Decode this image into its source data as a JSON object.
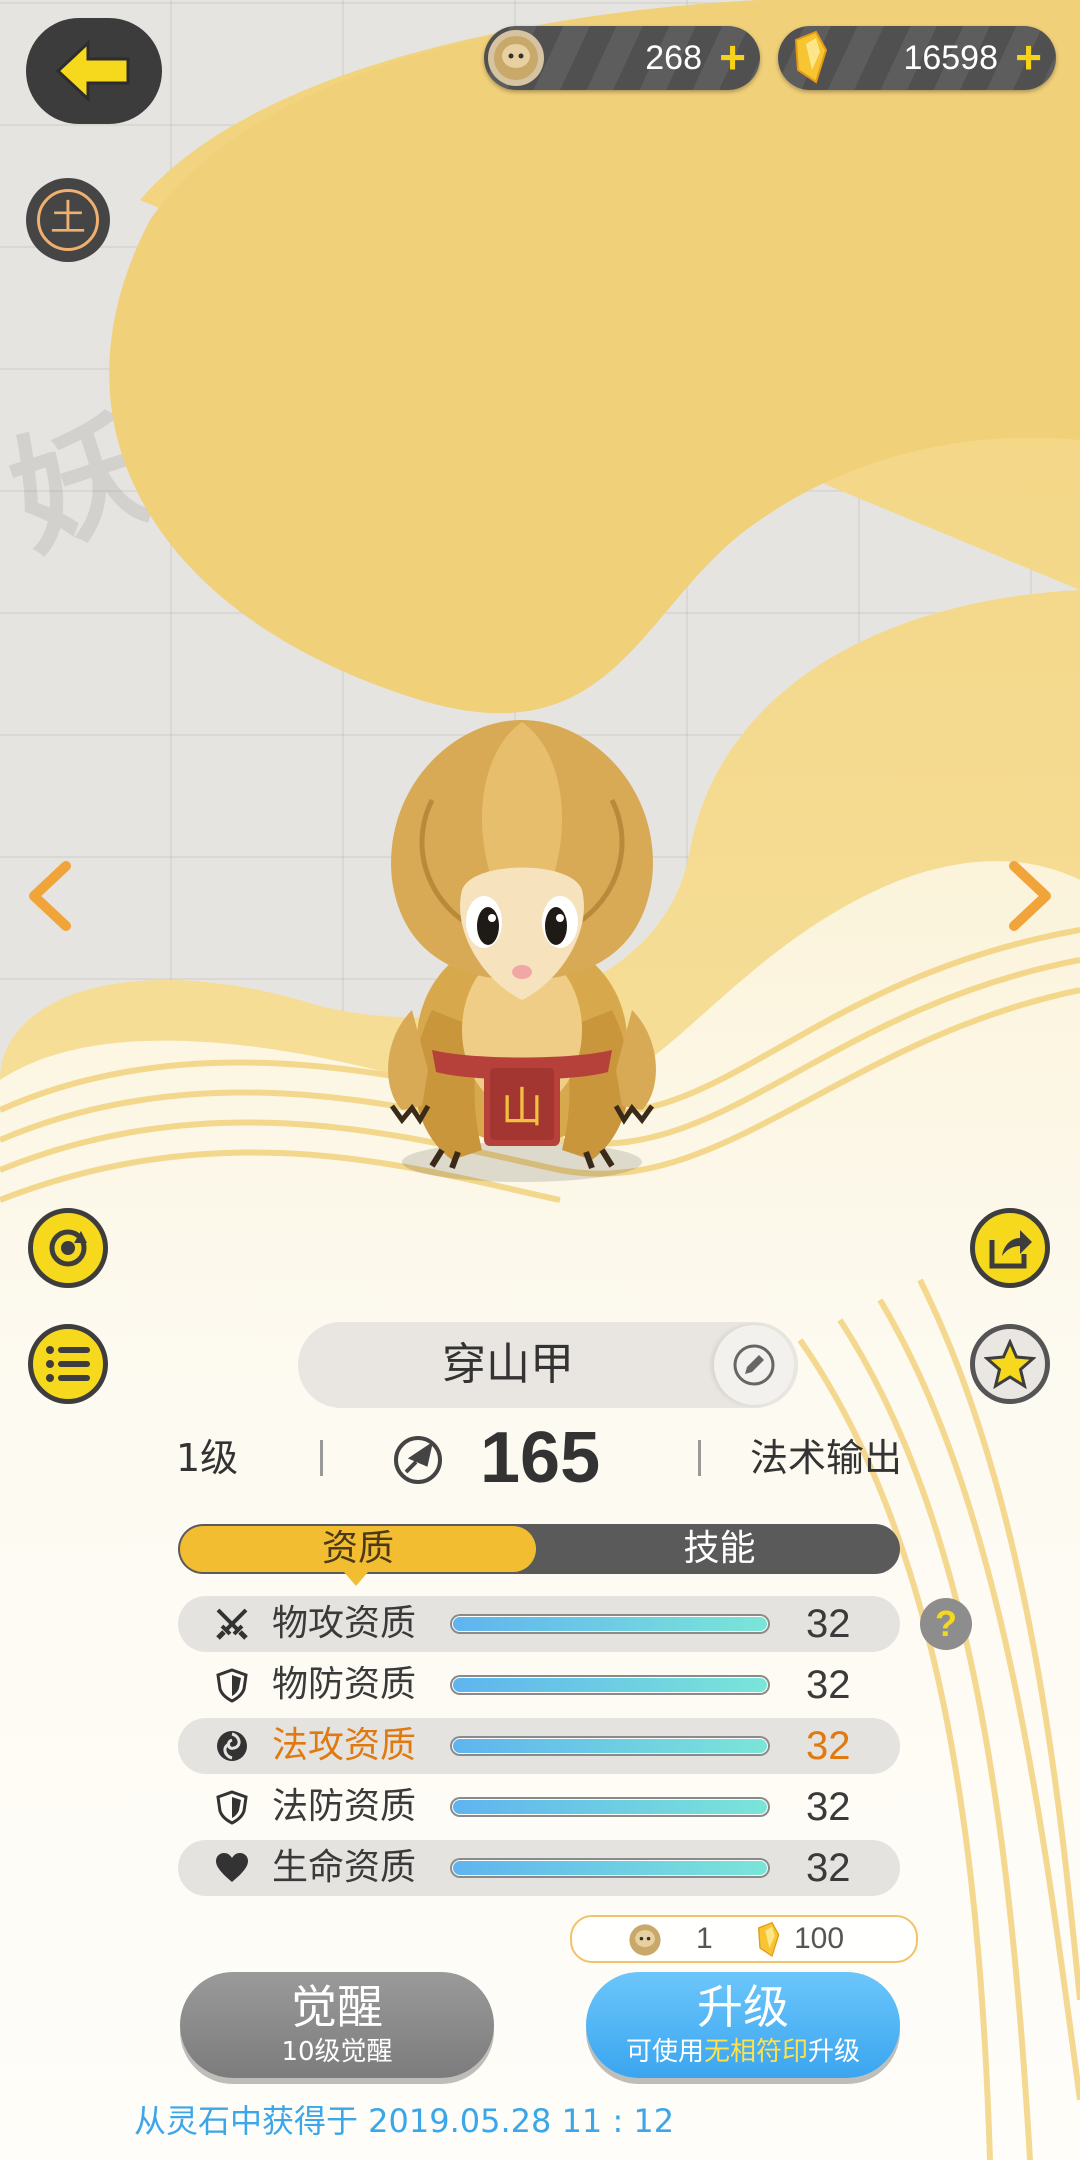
{
  "currency": {
    "creature_count": "268",
    "crystal_count": "16598",
    "plus": "+"
  },
  "element_badge": "土",
  "pet": {
    "name": "穿山甲",
    "level": "1级",
    "power": "165",
    "role": "法术输出",
    "belly_glyph": "山"
  },
  "tabs": [
    {
      "label": "资质",
      "active": true
    },
    {
      "label": "技能",
      "active": false
    }
  ],
  "attributes": [
    {
      "icon": "crossed-swords-icon",
      "label": "物攻资质",
      "value": "32",
      "fill": 1.0,
      "highlight": false
    },
    {
      "icon": "shield-icon",
      "label": "物防资质",
      "value": "32",
      "fill": 1.0,
      "highlight": false
    },
    {
      "icon": "magic-swirl-icon",
      "label": "法攻资质",
      "value": "32",
      "fill": 1.0,
      "highlight": true
    },
    {
      "icon": "shield-icon",
      "label": "法防资质",
      "value": "32",
      "fill": 1.0,
      "highlight": false
    },
    {
      "icon": "heart-icon",
      "label": "生命资质",
      "value": "32",
      "fill": 1.0,
      "highlight": false
    }
  ],
  "help": "?",
  "cost": {
    "creature_amount": "1",
    "crystal_amount": "100"
  },
  "awaken_button": {
    "label": "觉醒",
    "sub": "10级觉醒"
  },
  "upgrade_button": {
    "label": "升级",
    "sub_prefix": "可使用",
    "sub_highlight": "无相符印",
    "sub_suffix": "升级"
  },
  "footer": "从灵石中获得于 2019.05.28   11 : 12",
  "colors": {
    "accent_yellow": "#f6d81d",
    "tab_active": "#f3bd32",
    "highlight_orange": "#e07a10",
    "footer_blue": "#3ba6ea",
    "upgrade_blue": "#4cb2f5"
  }
}
